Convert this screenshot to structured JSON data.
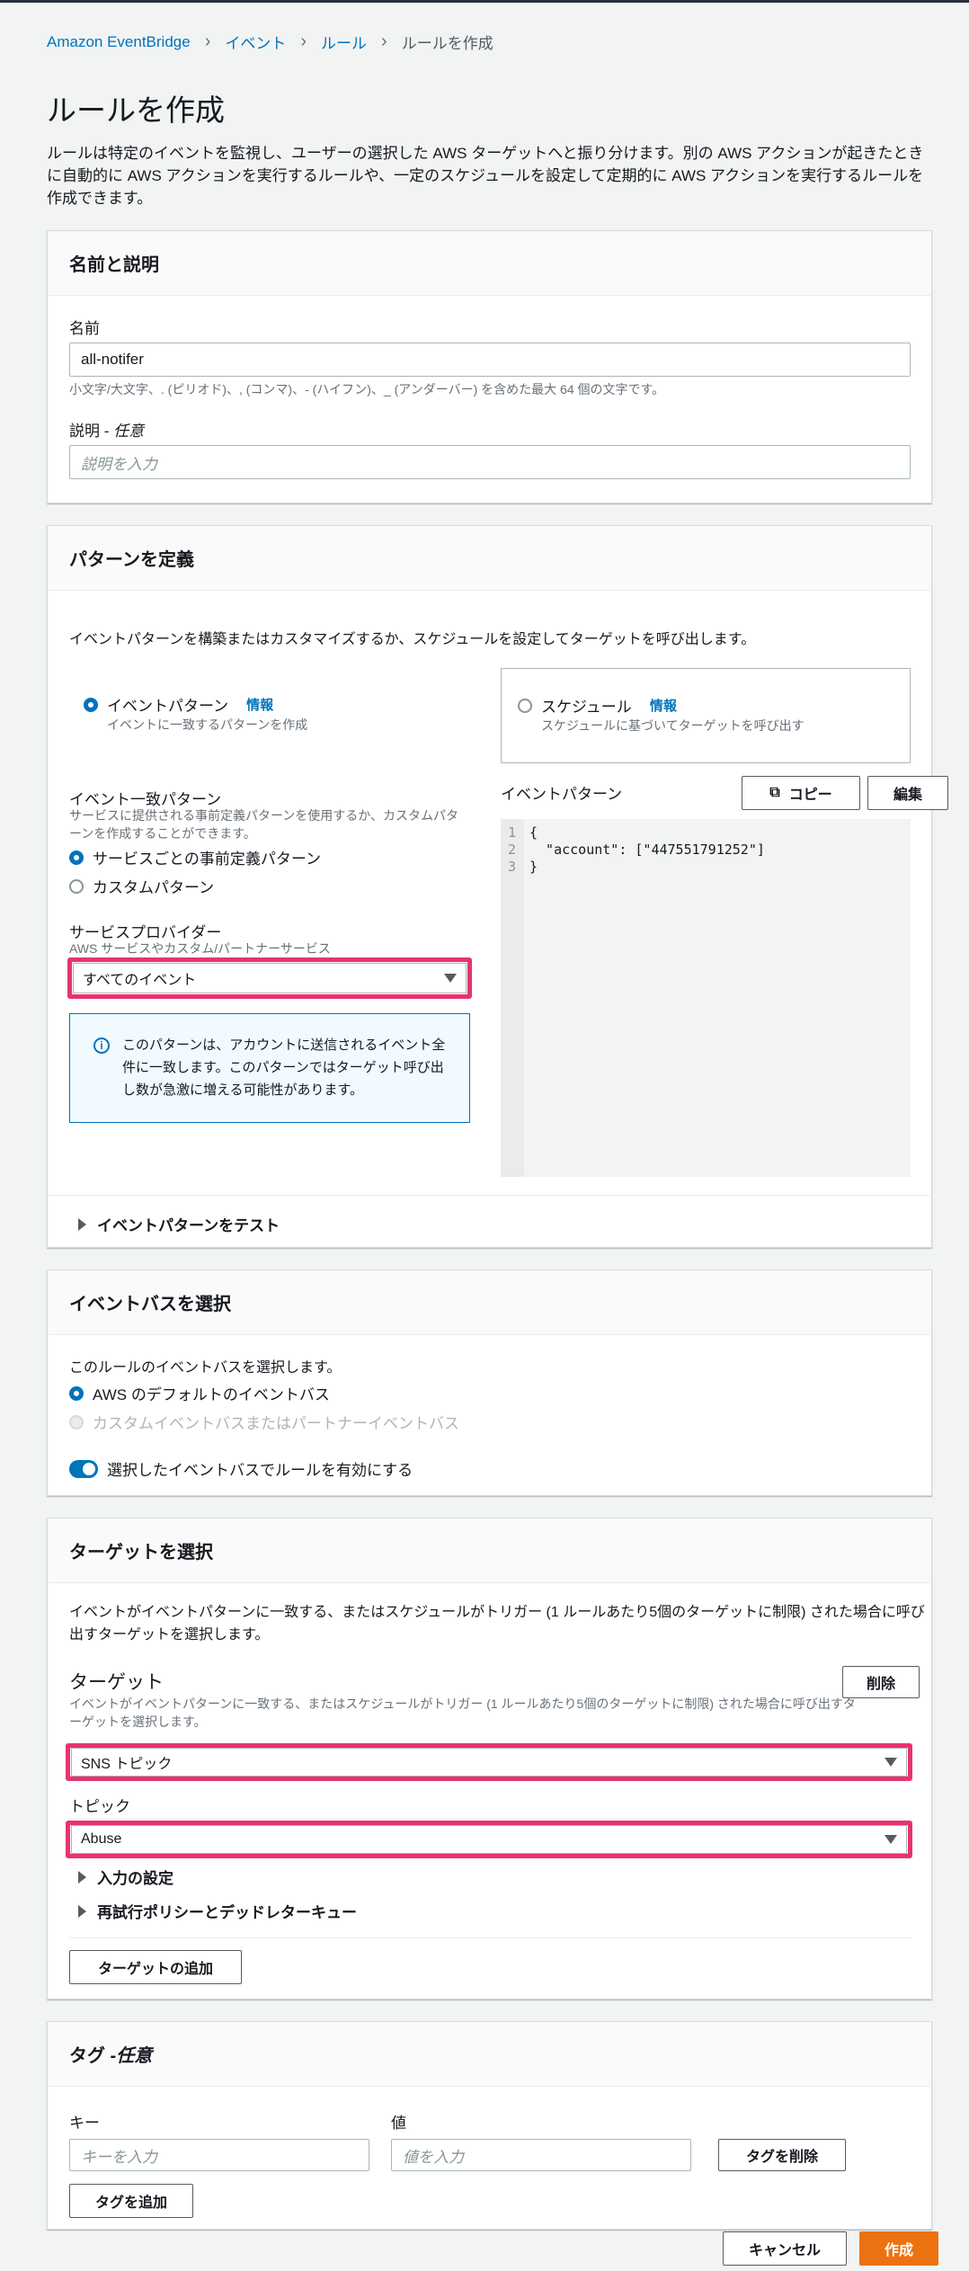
{
  "breadcrumb": {
    "items": [
      "Amazon EventBridge",
      "イベント",
      "ルール"
    ],
    "current": "ルールを作成"
  },
  "page": {
    "title": "ルールを作成",
    "intro": "ルールは特定のイベントを監視し、ユーザーの選択した AWS ターゲットへと振り分けます。別の AWS アクションが起きたときに自動的に AWS アクションを実行するルールや、一定のスケジュールを設定して定期的に AWS アクションを実行するルールを作成できます。"
  },
  "name_section": {
    "title": "名前と説明",
    "name_label": "名前",
    "name_value": "all-notifer",
    "name_hint": "小文字/大文字、. (ピリオド)、, (コンマ)、- (ハイフン)、_ (アンダーバー) を含めた最大 64 個の文字です。",
    "desc_label": "説明 - ",
    "desc_optional": "任意",
    "desc_placeholder": "説明を入力"
  },
  "pattern_section": {
    "title": "パターンを定義",
    "intro": "イベントパターンを構築またはカスタマイズするか、スケジュールを設定してターゲットを呼び出します。",
    "opt_event": "イベントパターン",
    "opt_event_desc": "イベントに一致するパターンを作成",
    "opt_schedule": "スケジュール",
    "opt_schedule_desc": "スケジュールに基づいてターゲットを呼び出す",
    "info": "情報",
    "match_label": "イベント一致パターン",
    "match_hint": "サービスに提供される事前定義パターンを使用するか、カスタムパターンを作成することができます。",
    "opt_predefined": "サービスごとの事前定義パターン",
    "opt_custom": "カスタムパターン",
    "provider_label": "サービスプロバイダー",
    "provider_hint": "AWS サービスやカスタム/パートナーサービス",
    "provider_value": "すべてのイベント",
    "alert_text": "このパターンは、アカウントに送信されるイベント全件に一致します。このパターンではターゲット呼び出し数が急激に増える可能性があります。",
    "pattern_label": "イベントパターン",
    "copy_btn": "コピー",
    "edit_btn": "編集",
    "code_lines": [
      "{",
      "  \"account\": [\"447551791252\"]",
      "}"
    ],
    "line_numbers": [
      "1",
      "2",
      "3"
    ],
    "test_label": "イベントパターンをテスト"
  },
  "bus_section": {
    "title": "イベントバスを選択",
    "intro": "このルールのイベントバスを選択します。",
    "opt_default": "AWS のデフォルトのイベントバス",
    "opt_custom": "カスタムイベントバスまたはパートナーイベントバス",
    "toggle_label": "選択したイベントバスでルールを有効にする"
  },
  "target_section": {
    "title": "ターゲットを選択",
    "intro": "イベントがイベントパターンに一致する、またはスケジュールがトリガー (1 ルールあたり5個のターゲットに制限) された場合に呼び出すターゲットを選択します。",
    "target_label": "ターゲット",
    "target_hint": "イベントがイベントパターンに一致する、またはスケジュールがトリガー (1 ルールあたり5個のターゲットに制限) された場合に呼び出すターゲットを選択します。",
    "delete_btn": "削除",
    "target_value": "SNS トピック",
    "topic_label": "トピック",
    "topic_value": "Abuse",
    "input_settings": "入力の設定",
    "retry_policy": "再試行ポリシーとデッドレターキュー",
    "add_target_btn": "ターゲットの追加"
  },
  "tag_section": {
    "title": "タグ - ",
    "title_optional": "任意",
    "key_label": "キー",
    "value_label": "値",
    "key_placeholder": "キーを入力",
    "value_placeholder": "値を入力",
    "remove_tag_btn": "タグを削除",
    "add_tag_btn": "タグを追加"
  },
  "footer": {
    "cancel_btn": "キャンセル",
    "create_btn": "作成"
  }
}
